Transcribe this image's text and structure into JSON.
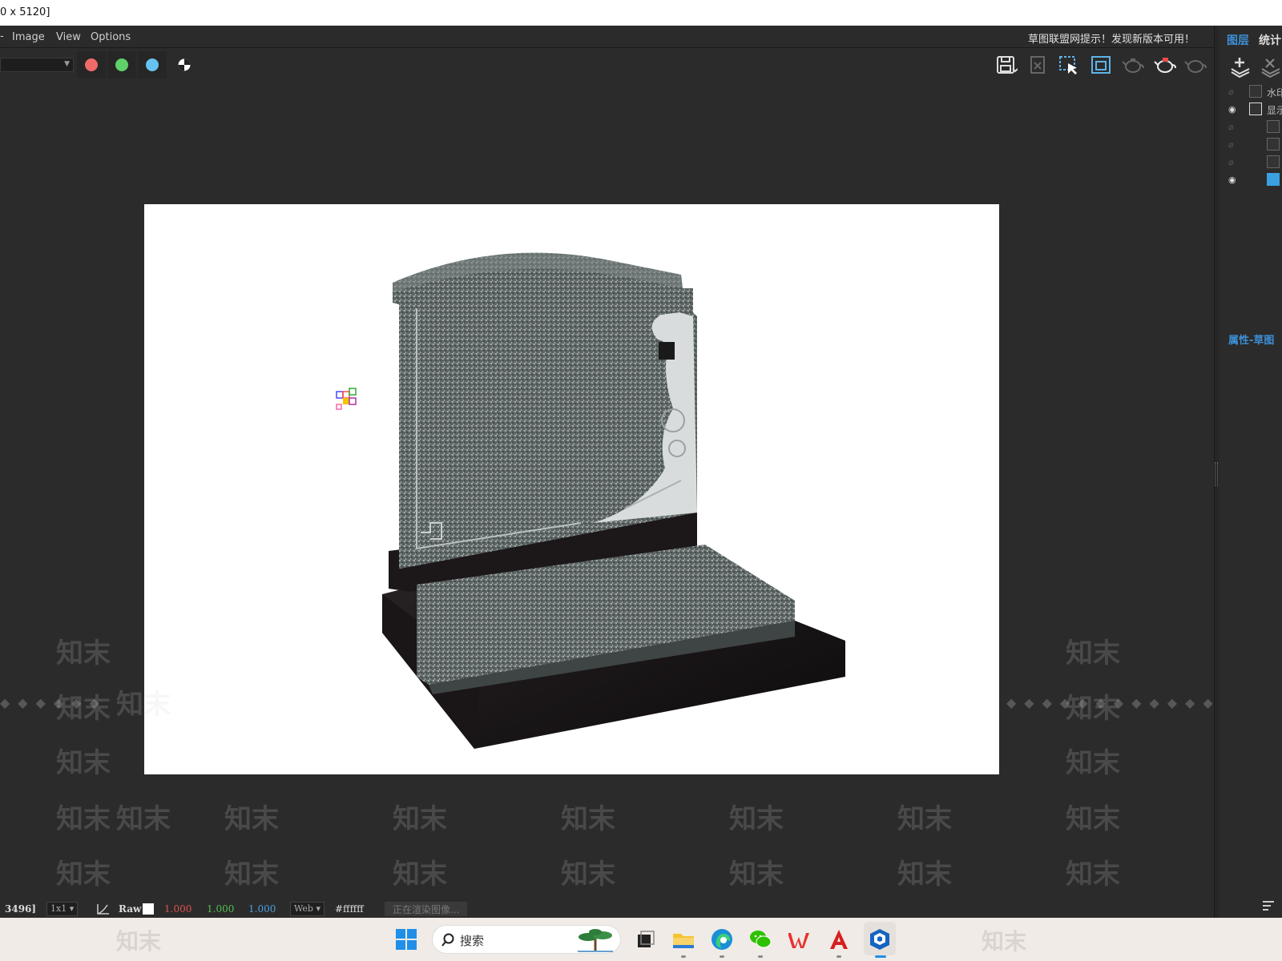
{
  "window": {
    "title": "0 x 5120]"
  },
  "menu": {
    "items": [
      "Image",
      "View",
      "Options"
    ],
    "notice": "草图联盟网提示！发现新版本可用！"
  },
  "toolbar": {
    "channel_buttons": [
      {
        "name": "red",
        "color": "#f06a6a"
      },
      {
        "name": "green",
        "color": "#5ed16a"
      },
      {
        "name": "blue",
        "color": "#66c2f0"
      },
      {
        "name": "alpha",
        "color": "#ffffff"
      }
    ],
    "right_icons": [
      "save-image-icon",
      "clear-image-icon",
      "region-render-icon",
      "frame-buffer-icon",
      "render-teapot-icon",
      "stop-render-teapot-icon",
      "render-last-teapot-icon"
    ]
  },
  "sidepanel": {
    "tabs": [
      "图层",
      "统计"
    ],
    "layers": [
      {
        "visible": false,
        "name": "水印"
      },
      {
        "visible": true,
        "name": "显示"
      },
      {
        "visible": false,
        "name": ""
      },
      {
        "visible": false,
        "name": ""
      },
      {
        "visible": false,
        "name": ""
      },
      {
        "visible": true,
        "name": ""
      }
    ],
    "properties_title": "属性-草图"
  },
  "statusbar": {
    "coords": "3496]",
    "zoom": "1x1",
    "mode": "Raw",
    "r": "1.000",
    "g": "1.000",
    "b": "1.000",
    "color_space": "Web",
    "hex": "#ffffff",
    "status": "正在渲染图像..."
  },
  "taskbar": {
    "search_placeholder": "搜索",
    "apps": [
      "windows-start-icon",
      "search-icon",
      "task-view-icon",
      "file-explorer-icon",
      "edge-browser-icon",
      "wechat-icon",
      "wps-office-icon",
      "acrobat-icon",
      "sketchup-icon"
    ]
  },
  "watermark": {
    "text": "知末"
  }
}
